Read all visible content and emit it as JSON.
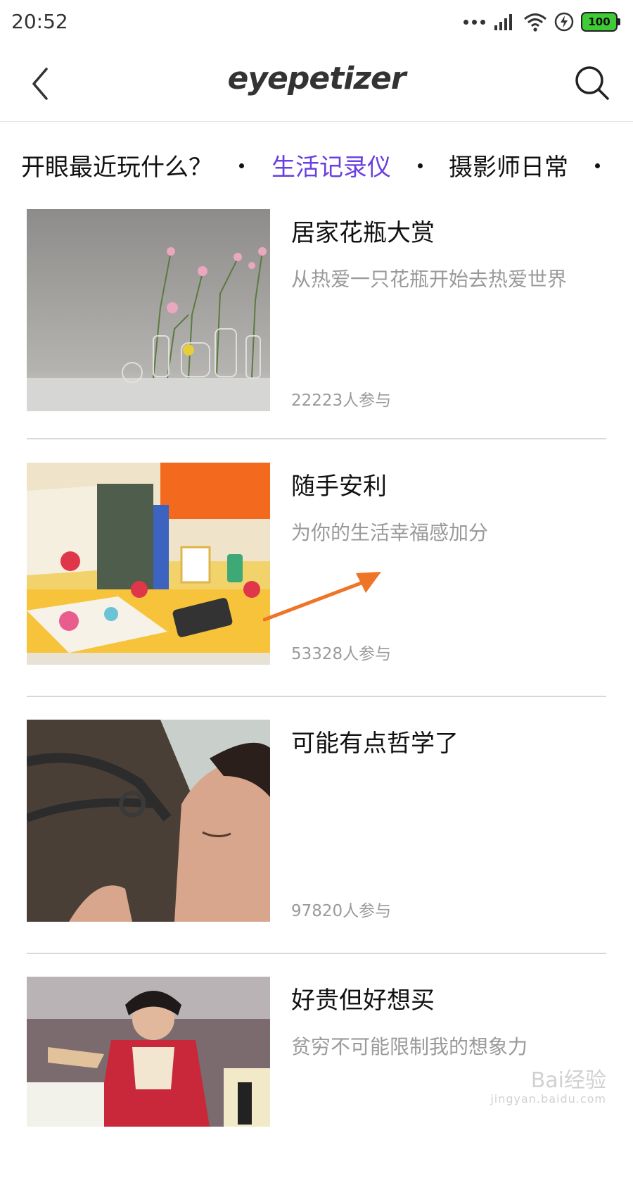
{
  "status_bar": {
    "time": "20:52",
    "battery": "100",
    "icons": [
      "signal-dots-icon",
      "cellular-signal-icon",
      "wifi-icon",
      "charging-icon",
      "battery-icon"
    ]
  },
  "app_bar": {
    "logo": "eyepetizer",
    "icons": [
      "back-arrow-icon",
      "search-icon"
    ]
  },
  "tabs": [
    {
      "label": "开眼最近玩什么？"
    },
    {
      "label": "生活记录仪",
      "active": true
    },
    {
      "label": "摄影师日常"
    }
  ],
  "accent_color": "#6a3ee0",
  "items": [
    {
      "title": "居家花瓶大赏",
      "subtitle": "从热爱一只花瓶开始去热爱世界",
      "count": "22223人参与"
    },
    {
      "title": "随手安利",
      "subtitle": "为你的生活幸福感加分",
      "count": "53328人参与"
    },
    {
      "title": "可能有点哲学了",
      "subtitle": "",
      "count": "97820人参与"
    },
    {
      "title": "好贵但好想买",
      "subtitle": "贫穷不可能限制我的想象力",
      "count": ""
    }
  ],
  "watermark": {
    "main": "Bai经验",
    "sub": "jingyan.baidu.com"
  }
}
